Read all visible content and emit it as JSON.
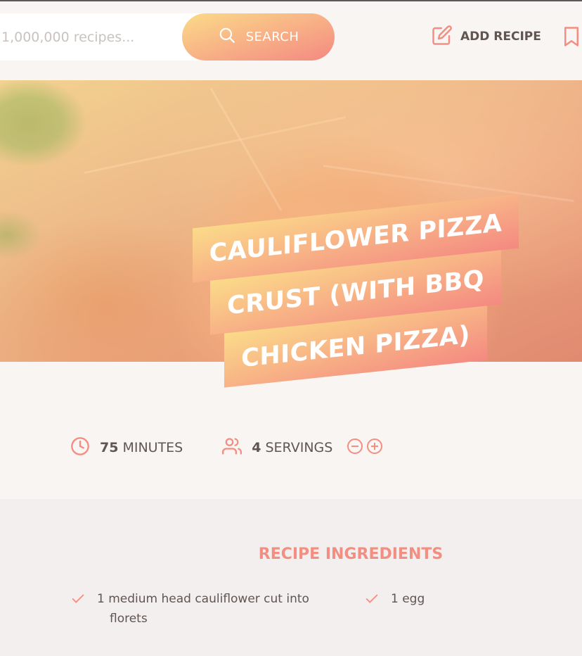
{
  "search": {
    "placeholder": "1,000,000 recipes...",
    "button_label": "SEARCH"
  },
  "nav": {
    "add_recipe_label": "ADD RECIPE"
  },
  "recipe": {
    "title_lines": [
      "CAULIFLOWER PIZZA",
      "CRUST (WITH BBQ",
      "CHICKEN PIZZA)"
    ],
    "cooking_time": "75",
    "cooking_time_unit": "MINUTES",
    "servings": "4",
    "servings_unit": "SERVINGS"
  },
  "ingredients": {
    "heading": "RECIPE INGREDIENTS",
    "items": [
      {
        "line1": "1 medium head cauliflower cut into",
        "line2": "florets"
      },
      {
        "line1": "1 egg",
        "line2": ""
      }
    ]
  },
  "colors": {
    "accent_start": "#fbdb89",
    "accent_end": "#f48982",
    "text": "#615551",
    "icon": "#f38e82"
  },
  "icons": {
    "search": "search-icon",
    "add_recipe": "edit-icon",
    "bookmark": "bookmark-icon",
    "time": "clock-icon",
    "servings": "users-icon",
    "decrease": "minus-circle-icon",
    "increase": "plus-circle-icon",
    "check": "check-icon"
  }
}
